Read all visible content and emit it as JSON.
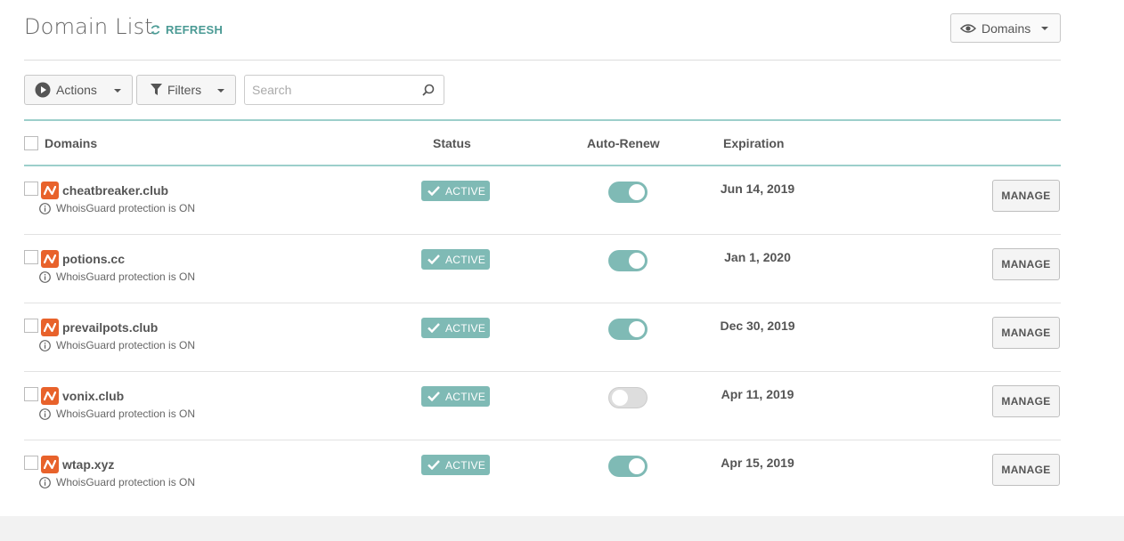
{
  "header": {
    "title": "Domain List",
    "refresh_label": "REFRESH",
    "view_dropdown_label": "Domains"
  },
  "toolbar": {
    "actions_label": "Actions",
    "filters_label": "Filters",
    "search_placeholder": "Search",
    "search_value": ""
  },
  "table": {
    "columns": [
      "Domains",
      "Status",
      "Auto-Renew",
      "Expiration"
    ],
    "rows": [
      {
        "domain": "cheatbreaker.club",
        "info": "WhoisGuard protection is ON",
        "status": "ACTIVE",
        "auto_renew": true,
        "expiration": "Jun 14, 2019",
        "action": "MANAGE"
      },
      {
        "domain": "potions.cc",
        "info": "WhoisGuard protection is ON",
        "status": "ACTIVE",
        "auto_renew": true,
        "expiration": "Jan 1, 2020",
        "action": "MANAGE"
      },
      {
        "domain": "prevailpots.club",
        "info": "WhoisGuard protection is ON",
        "status": "ACTIVE",
        "auto_renew": true,
        "expiration": "Dec 30, 2019",
        "action": "MANAGE"
      },
      {
        "domain": "vonix.club",
        "info": "WhoisGuard protection is ON",
        "status": "ACTIVE",
        "auto_renew": false,
        "expiration": "Apr 11, 2019",
        "action": "MANAGE"
      },
      {
        "domain": "wtap.xyz",
        "info": "WhoisGuard protection is ON",
        "status": "ACTIVE",
        "auto_renew": true,
        "expiration": "Apr 15, 2019",
        "action": "MANAGE"
      }
    ]
  },
  "colors": {
    "accent_teal": "#7fbab5",
    "refresh_teal": "#4a9a94",
    "brand_orange": "#e8622b"
  },
  "icons": [
    "refresh-icon",
    "eye-icon",
    "play-circle-icon",
    "filter-icon",
    "search-icon",
    "brand-logo-icon",
    "info-icon",
    "check-icon"
  ]
}
